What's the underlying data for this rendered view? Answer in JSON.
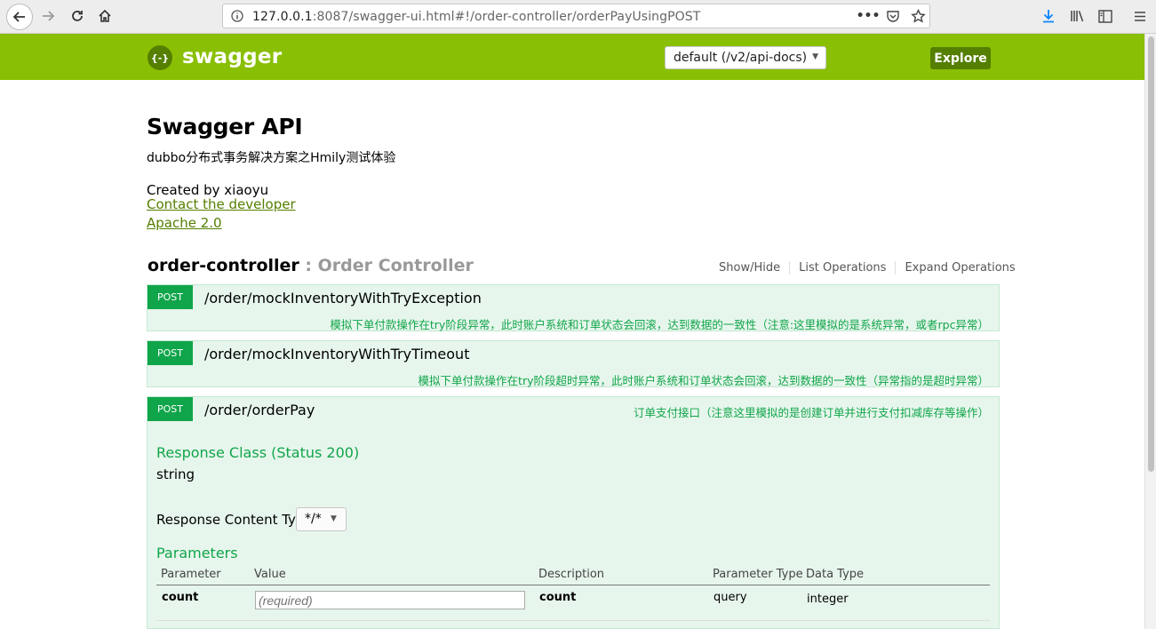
{
  "browser": {
    "url_host": "127.0.0.1",
    "url_rest": ":8087/swagger-ui.html#!/order-controller/orderPayUsingPOST",
    "info_icon": "info-icon",
    "more_icon": "ellipsis-icon"
  },
  "header": {
    "logo_symbol": "{-}",
    "logo_text": "swagger",
    "spec_select_value": "default (/v2/api-docs)",
    "explore_label": "Explore",
    "brand_color": "#89bf04"
  },
  "info": {
    "title": "Swagger API",
    "description": "dubbo分布式事务解决方案之Hmily测试体验",
    "created_by": "Created by xiaoyu",
    "contact_link": "Contact the developer",
    "license_link": "Apache 2.0"
  },
  "controller": {
    "name": "order-controller",
    "separator": " : ",
    "description": "Order Controller",
    "options": [
      "Show/Hide",
      "List Operations",
      "Expand Operations"
    ]
  },
  "operations": [
    {
      "method": "POST",
      "path": "/order/mockInventoryWithTryException",
      "summary": "模拟下单付款操作在try阶段异常，此时账户系统和订单状态会回滚，达到数据的一致性（注意:这里模拟的是系统异常，或者rpc异常）"
    },
    {
      "method": "POST",
      "path": "/order/mockInventoryWithTryTimeout",
      "summary": "模拟下单付款操作在try阶段超时异常，此时账户系统和订单状态会回滚，达到数据的一致性（异常指的是超时异常）"
    },
    {
      "method": "POST",
      "path": "/order/orderPay",
      "summary": "订单支付接口（注意这里模拟的是创建订单并进行支付扣减库存等操作）"
    }
  ],
  "expanded": {
    "response_class_heading": "Response Class (Status 200)",
    "response_class_value": "string",
    "content_type_label": "Response Content Type",
    "content_type_value": "*/*",
    "parameters_heading": "Parameters",
    "columns": [
      "Parameter",
      "Value",
      "Description",
      "Parameter Type",
      "Data Type"
    ],
    "params": [
      {
        "name": "count",
        "placeholder": "(required)",
        "description": "count",
        "param_type": "query",
        "data_type": "integer"
      }
    ]
  },
  "colors": {
    "post_green": "#10a54a",
    "link_green": "#547f00"
  }
}
